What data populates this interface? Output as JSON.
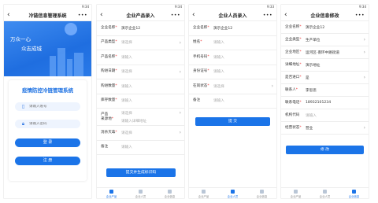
{
  "phones": [
    {
      "status_time": "9:34",
      "title": "冷链信息管理系统",
      "hero_line1": "万众一心",
      "hero_line2": "众志成城",
      "login_title": "疫情防控冷链管理系统",
      "account_placeholder": "请输入账号",
      "password_placeholder": "请输入密码",
      "login_label": "登 录",
      "register_label": "注 册"
    },
    {
      "status_time": "9:34",
      "title": "企业产品录入",
      "fields": [
        {
          "label": "企业名称",
          "required": true,
          "value": "演示企业12",
          "placeholder": "",
          "arrow": false
        },
        {
          "label": "产品类型",
          "required": true,
          "value": "",
          "placeholder": "请选择",
          "arrow": true
        },
        {
          "label": "产品名称",
          "required": true,
          "value": "",
          "placeholder": "请输入",
          "arrow": false
        },
        {
          "label": "购进日期",
          "required": true,
          "value": "",
          "placeholder": "请选择",
          "arrow": true
        },
        {
          "label": "购进数量",
          "required": true,
          "value": "",
          "placeholder": "请输入",
          "arrow": false
        },
        {
          "label": "库存数量",
          "required": true,
          "value": "",
          "placeholder": "请输入",
          "arrow": false
        }
      ],
      "origin_label_1": "产品",
      "origin_label_2": "来源地",
      "origin_placeholder_1": "请选择",
      "origin_placeholder_2": "请输入详细地址",
      "disinfect_label": "消杀灭毒",
      "disinfect_placeholder": "请选择",
      "remark_label": "备注",
      "remark_placeholder": "请输入",
      "submit_label": "提交并生成标识码",
      "tabs": [
        "企业产品",
        "企业人员",
        "企业信息"
      ]
    },
    {
      "status_time": "9:33",
      "title": "企业人员录入",
      "fields": [
        {
          "label": "企业名称",
          "required": true,
          "value": "演示企业12",
          "placeholder": "",
          "arrow": false
        },
        {
          "label": "姓名",
          "required": true,
          "value": "",
          "placeholder": "请输入",
          "arrow": false
        },
        {
          "label": "手机号码",
          "required": true,
          "value": "",
          "placeholder": "请输入",
          "arrow": false
        },
        {
          "label": "身份证号",
          "required": true,
          "value": "",
          "placeholder": "请输入",
          "arrow": false
        },
        {
          "label": "在岗状态",
          "required": true,
          "value": "",
          "placeholder": "请选择",
          "arrow": true
        },
        {
          "label": "备注",
          "required": false,
          "value": "",
          "placeholder": "请输入",
          "arrow": false
        }
      ],
      "submit_label": "提 交",
      "tabs": [
        "企业产品",
        "企业人员",
        "企业信息"
      ]
    },
    {
      "status_time": "9:34",
      "title": "企业信息修改",
      "fields": [
        {
          "label": "企业名称",
          "required": true,
          "value": "演示企业12",
          "placeholder": "",
          "arrow": false
        },
        {
          "label": "企业类型",
          "required": true,
          "value": "生产单位",
          "placeholder": "",
          "arrow": true
        },
        {
          "label": "企业地区",
          "required": true,
          "value": "运河区-南环中路街道",
          "placeholder": "",
          "arrow": true
        },
        {
          "label": "详细地址",
          "required": true,
          "value": "演示地址",
          "placeholder": "",
          "arrow": false
        },
        {
          "label": "是否进口",
          "required": true,
          "value": "是",
          "placeholder": "",
          "arrow": true
        },
        {
          "label": "联系人",
          "required": true,
          "value": "李思思",
          "placeholder": "",
          "arrow": false
        },
        {
          "label": "联系电话",
          "required": true,
          "value": "18932101234",
          "placeholder": "",
          "arrow": false
        },
        {
          "label": "机构代码",
          "required": false,
          "value": "",
          "placeholder": "请输入",
          "arrow": false
        },
        {
          "label": "经营状态",
          "required": true,
          "value": "营业",
          "placeholder": "",
          "arrow": true
        }
      ],
      "submit_label": "修 改",
      "tabs": [
        "企业产品",
        "企业人员",
        "企业信息"
      ]
    }
  ],
  "colors": {
    "primary": "#1b74e8",
    "hero_top": "#3f8cf0",
    "required": "#e33333"
  }
}
